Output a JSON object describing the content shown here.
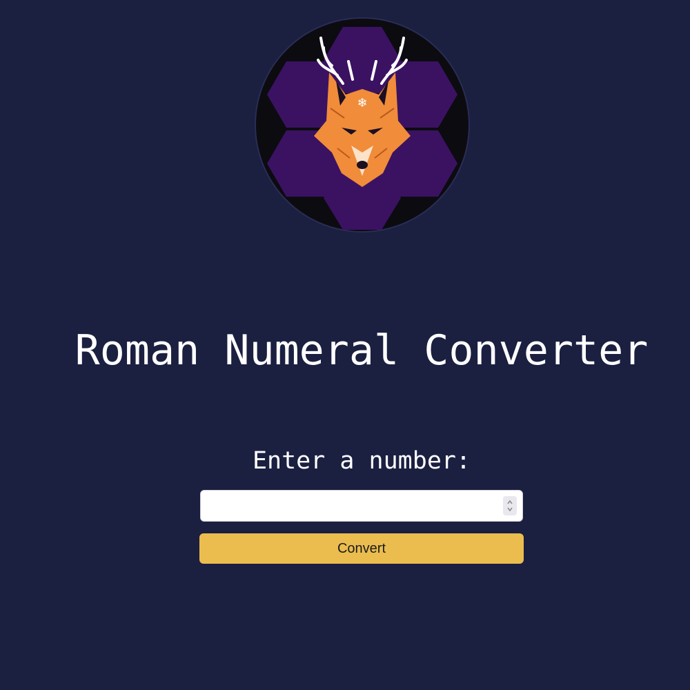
{
  "logo": {
    "name": "fox-antlers-logo",
    "colors": {
      "ring": "#0c0b10",
      "hexagon": "#3b1262",
      "fox": "#f08c3a",
      "antler": "#ffffff"
    }
  },
  "header": {
    "title": "Roman Numeral Converter"
  },
  "form": {
    "label": "Enter a number:",
    "input_value": "",
    "button_label": "Convert"
  },
  "theme": {
    "background": "#1b1f40",
    "button": "#ebbd4f",
    "text": "#ffffff"
  }
}
